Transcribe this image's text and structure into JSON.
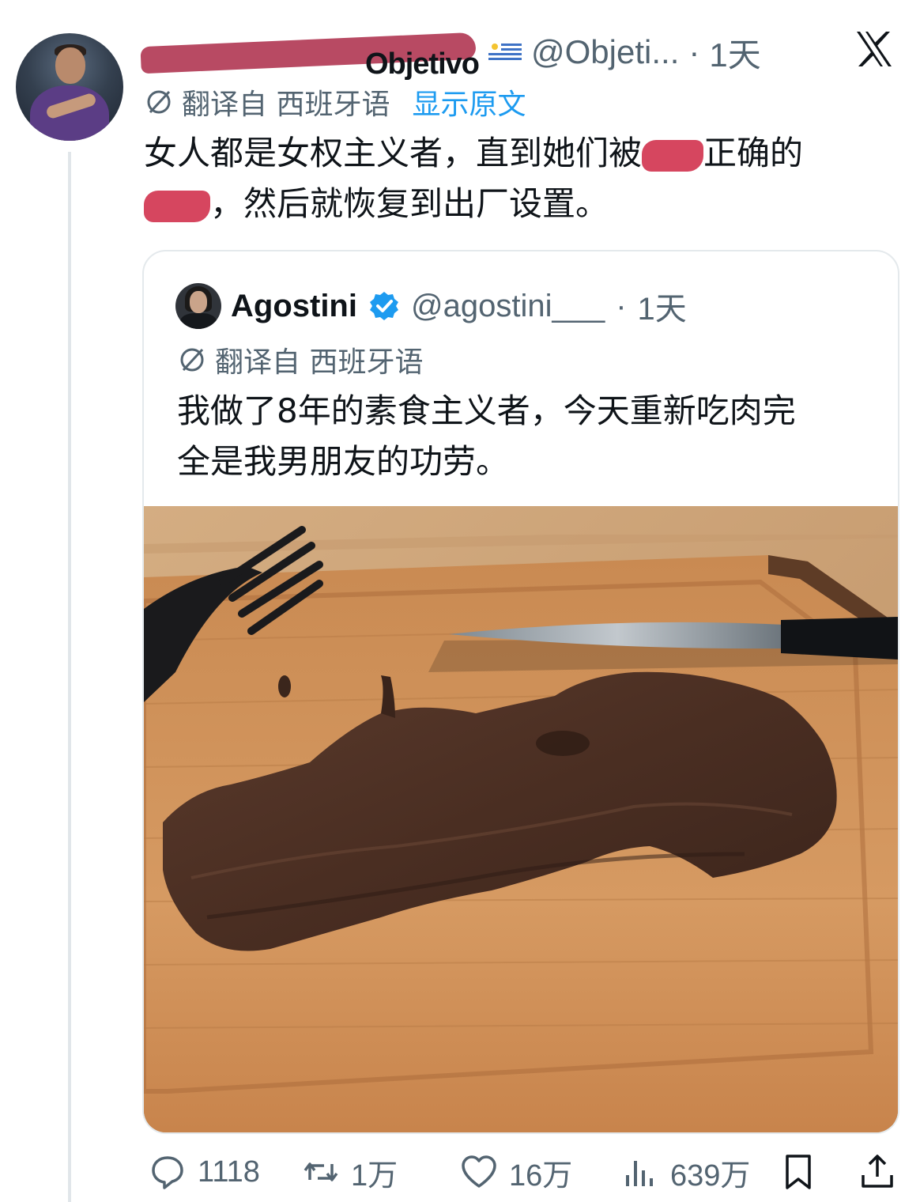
{
  "tweet": {
    "author_name_visible": "Objetivo",
    "handle": "@Objeti...",
    "time": "1天",
    "translate_label": "翻译自 西班牙语",
    "show_original": "显示原文",
    "text_line1_a": "女人都是女权主义者，直到她们被",
    "text_line1_b": "正确的",
    "text_line2_b": "，然后就恢复到出厂设置。"
  },
  "quote": {
    "name": "Agostini",
    "handle": "@agostini___",
    "time": "1天",
    "translate_label": "翻译自 西班牙语",
    "text_line1": "我做了8年的素食主义者，今天重新吃肉完",
    "text_line2": "全是我男朋友的功劳。"
  },
  "actions": {
    "replies": "1118",
    "retweets": "1万",
    "likes": "16万",
    "views": "639万"
  },
  "icons": {
    "header": [
      "x-logo-icon",
      "uruguay-flag-icon"
    ],
    "quote": [
      "verified-badge-icon"
    ],
    "actions": [
      "reply-icon",
      "retweet-icon",
      "like-icon",
      "views-icon",
      "bookmark-icon",
      "share-icon"
    ]
  },
  "colors": {
    "link_blue": "#1d9bf0",
    "secondary_text": "#536471",
    "redaction": "#d6465f"
  }
}
